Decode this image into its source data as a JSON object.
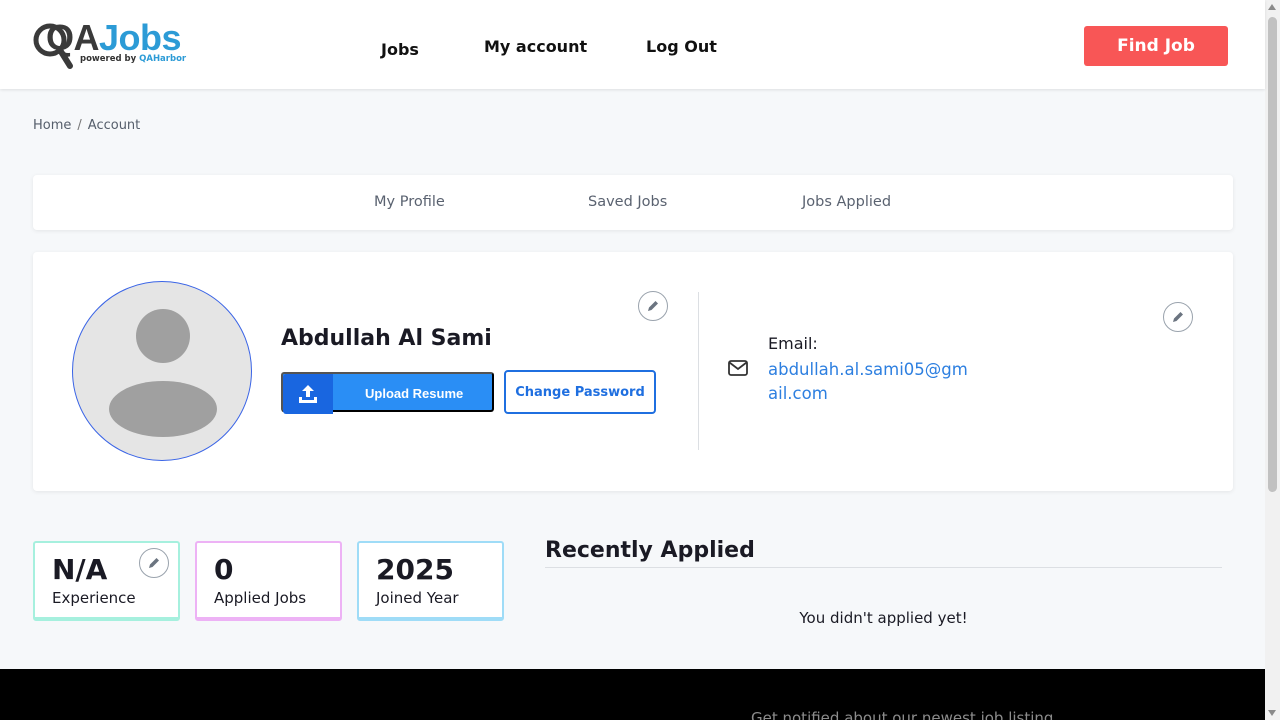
{
  "header": {
    "logo": {
      "text_main_a": "QA",
      "text_main_b": "Jobs",
      "tagline_prefix": "powered by ",
      "tagline_brand": "QAHarbor"
    },
    "nav": [
      {
        "label": "Jobs"
      },
      {
        "label": "My account"
      },
      {
        "label": "Log Out"
      }
    ],
    "cta_label": "Find Job"
  },
  "breadcrumb": {
    "home": "Home",
    "separator": "/",
    "current": "Account"
  },
  "tabs": [
    {
      "label": "My Profile"
    },
    {
      "label": "Saved Jobs"
    },
    {
      "label": "Jobs Applied"
    }
  ],
  "profile": {
    "name": "Abdullah Al Sami",
    "upload_label": "Upload Resume",
    "change_password_label": "Change Password",
    "email_label": "Email:",
    "email_value": "abdullah.al.sami05@gmail.com"
  },
  "stats": [
    {
      "value": "N/A",
      "label": "Experience",
      "border_color": "#a6f0de"
    },
    {
      "value": "0",
      "label": "Applied Jobs",
      "border_color": "#edb2f5"
    },
    {
      "value": "2025",
      "label": "Joined Year",
      "border_color": "#9fdcf7"
    }
  ],
  "recent": {
    "title": "Recently Applied",
    "empty_message": "You didn't applied yet!"
  },
  "footer": {
    "text": "Get notified about our newest job listing"
  },
  "icons": {
    "logo": "magnifier-logo-icon",
    "edit": "pencil-icon",
    "upload": "upload-icon",
    "email": "envelope-icon",
    "avatar": "user-avatar-icon"
  },
  "colors": {
    "accent_red": "#f85656",
    "primary_blue": "#2a8ef5",
    "link_blue": "#2d7fe0",
    "logo_blue": "#2c9bd6"
  }
}
